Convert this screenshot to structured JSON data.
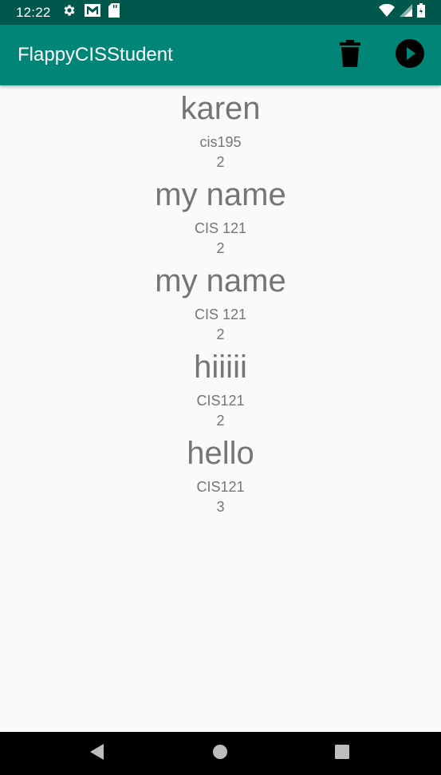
{
  "status_bar": {
    "time": "12:22",
    "icons_left": [
      "gear-icon",
      "gmail-icon",
      "sd-card-icon"
    ],
    "icons_right": [
      "wifi-icon",
      "signal-icon",
      "battery-icon"
    ]
  },
  "app_bar": {
    "title": "FlappyCISStudent",
    "actions": [
      "delete-icon",
      "play-icon"
    ],
    "color": "#008577",
    "status_color": "#00574b"
  },
  "entries": [
    {
      "name": "karen",
      "course": "cis195",
      "score": "2"
    },
    {
      "name": "my name",
      "course": "CIS 121",
      "score": "2"
    },
    {
      "name": "my name",
      "course": "CIS 121",
      "score": "2"
    },
    {
      "name": "hiiiii",
      "course": "CIS121",
      "score": "2"
    },
    {
      "name": "hello",
      "course": "CIS121",
      "score": "3"
    }
  ],
  "nav_bar": {
    "buttons": [
      "back-icon",
      "home-icon",
      "recents-icon"
    ]
  }
}
